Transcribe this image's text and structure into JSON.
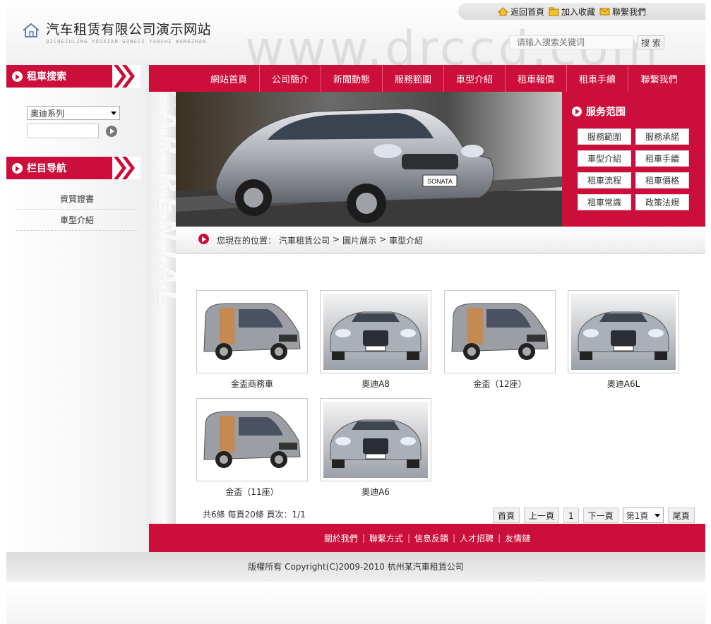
{
  "header": {
    "site_title": "汽车租赁有限公司演示网站",
    "site_subtitle": "QICHEZULING YOUXIAN GONGSI YANSHI WANGZHAN",
    "watermark": "www.drccd.com",
    "top_links": [
      {
        "label": "返回首頁",
        "icon": "home-icon"
      },
      {
        "label": "加入收藏",
        "icon": "folder-icon"
      },
      {
        "label": "聯繫我們",
        "icon": "mail-icon"
      }
    ],
    "search_placeholder": "请输入搜索关键词",
    "search_button": "搜 索"
  },
  "sidebar": {
    "search_title": "租車搜索",
    "brand_select_value": "奧迪系列",
    "nav_title": "栏目导航",
    "nav_items": [
      "資質證書",
      "車型介紹"
    ],
    "vertical_text": "CAR RENTAL"
  },
  "nav": {
    "items": [
      "網站首頁",
      "公司簡介",
      "新聞動態",
      "服務範圍",
      "車型介紹",
      "租車報價",
      "租車手續",
      "聯繫我們"
    ]
  },
  "banner": {
    "plate": "SONATA"
  },
  "services": {
    "title": "服务范围",
    "items": [
      "服務範圍",
      "服務承諾",
      "車型介紹",
      "租車手續",
      "租車流程",
      "租車價格",
      "租車常識",
      "政策法規"
    ]
  },
  "breadcrumb": {
    "prefix": "您現在的位置：",
    "path": [
      "汽車租賃公司",
      "圖片展示",
      "車型介紹"
    ],
    "separator": ">"
  },
  "gallery": [
    {
      "caption": "金盃商務車",
      "icon": "van-icon"
    },
    {
      "caption": "奧迪A8",
      "icon": "sedan-icon"
    },
    {
      "caption": "金盃（12座）",
      "icon": "van-icon"
    },
    {
      "caption": "奧迪A6L",
      "icon": "sedan-icon"
    },
    {
      "caption": "金盃（11座）",
      "icon": "van-icon"
    },
    {
      "caption": "奧迪A6",
      "icon": "sedan-icon"
    }
  ],
  "pagination": {
    "info": "共6條 每頁20條 頁次：1/1",
    "first": "首頁",
    "prev": "上一頁",
    "current": "1",
    "next": "下一頁",
    "select_value": "第1頁",
    "last": "尾頁"
  },
  "footer": {
    "links": [
      "關於我們",
      "聯繫方式",
      "信息反饋",
      "人才招聘",
      "友情鏈"
    ],
    "copyright": "版權所有 Copyright(C)2009-2010 杭州某汽車租賃公司"
  },
  "colors": {
    "brand_red": "#cc0e3a"
  }
}
